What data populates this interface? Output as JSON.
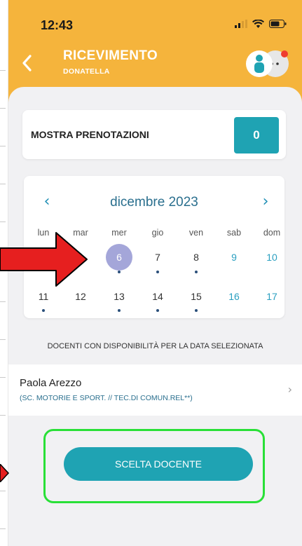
{
  "status": {
    "time": "12:43"
  },
  "header": {
    "title": "RICEVIMENTO",
    "subtitle": "DONATELLA"
  },
  "bookings": {
    "label": "MOSTRA PRENOTAZIONI",
    "count": "0"
  },
  "calendar": {
    "month": "dicembre 2023",
    "prev": "‹",
    "next": "›",
    "weekdays": [
      "lun",
      "mar",
      "mer",
      "gio",
      "ven",
      "sab",
      "dom"
    ],
    "week1": [
      "6",
      "7",
      "8",
      "9",
      "10"
    ],
    "week2": [
      "11",
      "12",
      "13",
      "14",
      "15",
      "16",
      "17"
    ],
    "selected": "6"
  },
  "section_note": "DOCENTI CON DISPONIBILITÀ PER LA DATA SELEZIONATA",
  "teacher": {
    "name": "Paola Arezzo",
    "subjects": "(SC. MOTORIE E SPORT. // TEC.DI COMUN.REL**)"
  },
  "choose_button": "SCELTA DOCENTE",
  "colors": {
    "header_bg": "#f5b43c",
    "accent": "#1fa3b3",
    "selected_day": "#a4a6d9",
    "highlight_frame": "#29e037",
    "annotation_arrow": "#e61f1f"
  }
}
